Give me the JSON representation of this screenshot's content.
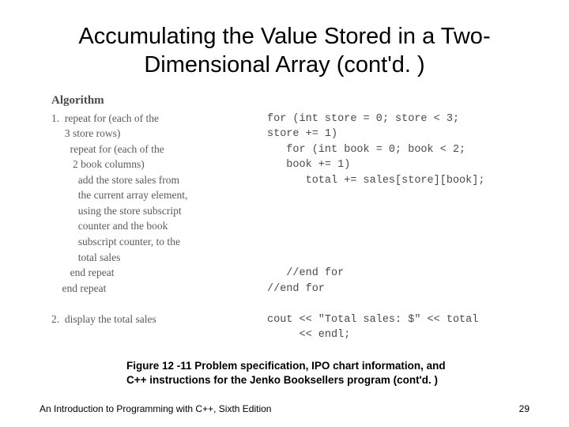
{
  "title": "Accumulating the Value Stored in a Two-Dimensional Array (cont'd. )",
  "algoHeading": "Algorithm",
  "pseudo": "1.  repeat for (each of the\n     3 store rows)\n       repeat for (each of the\n        2 book columns)\n          add the store sales from\n          the current array element,\n          using the store subscript\n          counter and the book\n          subscript counter, to the\n          total sales\n       end repeat\n    end repeat\n\n2.  display the total sales",
  "code": "for (int store = 0; store < 3;\nstore += 1)\n   for (int book = 0; book < 2;\n   book += 1)\n      total += sales[store][book];\n\n\n\n\n\n   //end for\n//end for\n\ncout << \"Total sales: $\" << total\n     << endl;",
  "caption": "Figure 12 -11 Problem specification, IPO chart information, and C++ instructions for the Jenko Booksellers program (cont'd. )",
  "footerLeft": "An Introduction to Programming with C++, Sixth Edition",
  "footerRight": "29"
}
